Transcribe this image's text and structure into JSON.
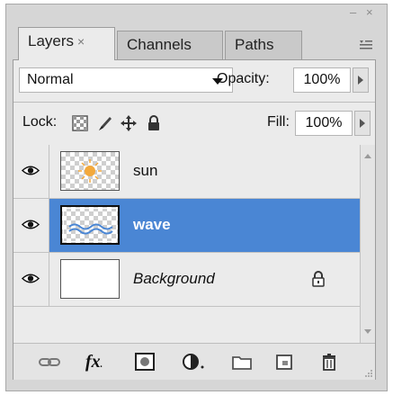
{
  "window": {
    "minimize_glyph": "–",
    "close_glyph": "×"
  },
  "tabs": [
    {
      "label": "Layers",
      "close": "×",
      "active": true
    },
    {
      "label": "Channels",
      "active": false
    },
    {
      "label": "Paths",
      "active": false
    }
  ],
  "panel_menu_icon": "panel-menu-icon",
  "blend": {
    "mode": "Normal",
    "opacity_label": "Opacity:",
    "opacity_value": "100%"
  },
  "lock": {
    "label": "Lock:",
    "icons": [
      "lock-transparent-pixels-icon",
      "lock-image-pixels-icon",
      "lock-position-icon",
      "lock-all-icon"
    ],
    "fill_label": "Fill:",
    "fill_value": "100%"
  },
  "layers": [
    {
      "name": "sun",
      "visible": true,
      "selected": false,
      "thumbnail": "transparent-with-sun"
    },
    {
      "name": "wave",
      "visible": true,
      "selected": true,
      "thumbnail": "transparent-with-wave"
    },
    {
      "name": "Background",
      "visible": true,
      "selected": false,
      "italic": true,
      "locked": true,
      "thumbnail": "white"
    }
  ],
  "toolbar": {
    "buttons": [
      "link-layers-icon",
      "fx-icon",
      "layer-mask-icon",
      "adjustment-layer-icon",
      "new-group-icon",
      "new-layer-icon",
      "trash-icon"
    ],
    "fx_label": "fx"
  },
  "colors": {
    "selection": "#4a86d4",
    "panel_bg": "#ebebeb",
    "frame_bg": "#d6d6d6"
  }
}
